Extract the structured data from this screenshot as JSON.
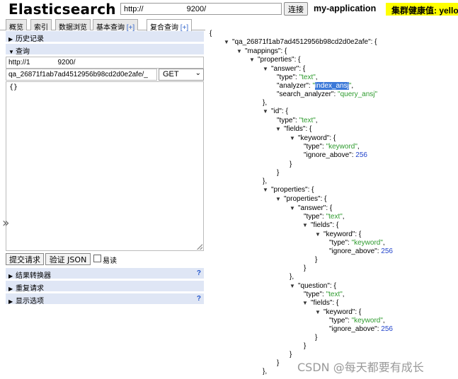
{
  "header": {
    "title": "Elasticsearch",
    "url": "http://                    9200/",
    "connect_label": "连接",
    "cluster_name": "my-application",
    "health_label": "集群健康值: yellow"
  },
  "tabs": [
    {
      "label": "概览",
      "plus": ""
    },
    {
      "label": "索引",
      "plus": ""
    },
    {
      "label": "数据浏览",
      "plus": ""
    },
    {
      "label": "基本查询 ",
      "plus": "[+]"
    },
    {
      "label": "复合查询 ",
      "plus": "[+]"
    }
  ],
  "query_panel": {
    "history_label": "历史记录",
    "query_label": "查询",
    "base_url": "http://1              9200/",
    "path": "qa_26871f1ab7ad4512956b98cd2d0e2afe/_",
    "method": "GET",
    "body": "{}",
    "submit_label": "提交请求",
    "validate_label": "验证 JSON",
    "pretty_label": "易读",
    "result_transformer_label": "结果转换器",
    "repeat_request_label": "重复请求",
    "display_options_label": "显示选项",
    "help_mark": "?"
  },
  "json_lines": [
    "{",
    "\"qa_26871f1ab7ad4512956b98cd2d0e2afe\": {",
    "\"mappings\": {",
    "\"properties\": {",
    "\"answer\": {",
    "\"type\": ",
    "\"text\"",
    "\"analyzer\": ",
    "\"",
    "index_ansj",
    "\"",
    "\"search_analyzer\": ",
    "\"query_ansj\"",
    "},",
    "\"id\": {",
    "\"fields\": {",
    "\"keyword\": {",
    "\"keyword\"",
    "\"ignore_above\": ",
    "256",
    "}",
    "\"properties\": {",
    "\"question\": {",
    "},"
  ],
  "watermark": "CSDN @每天都要有成长"
}
